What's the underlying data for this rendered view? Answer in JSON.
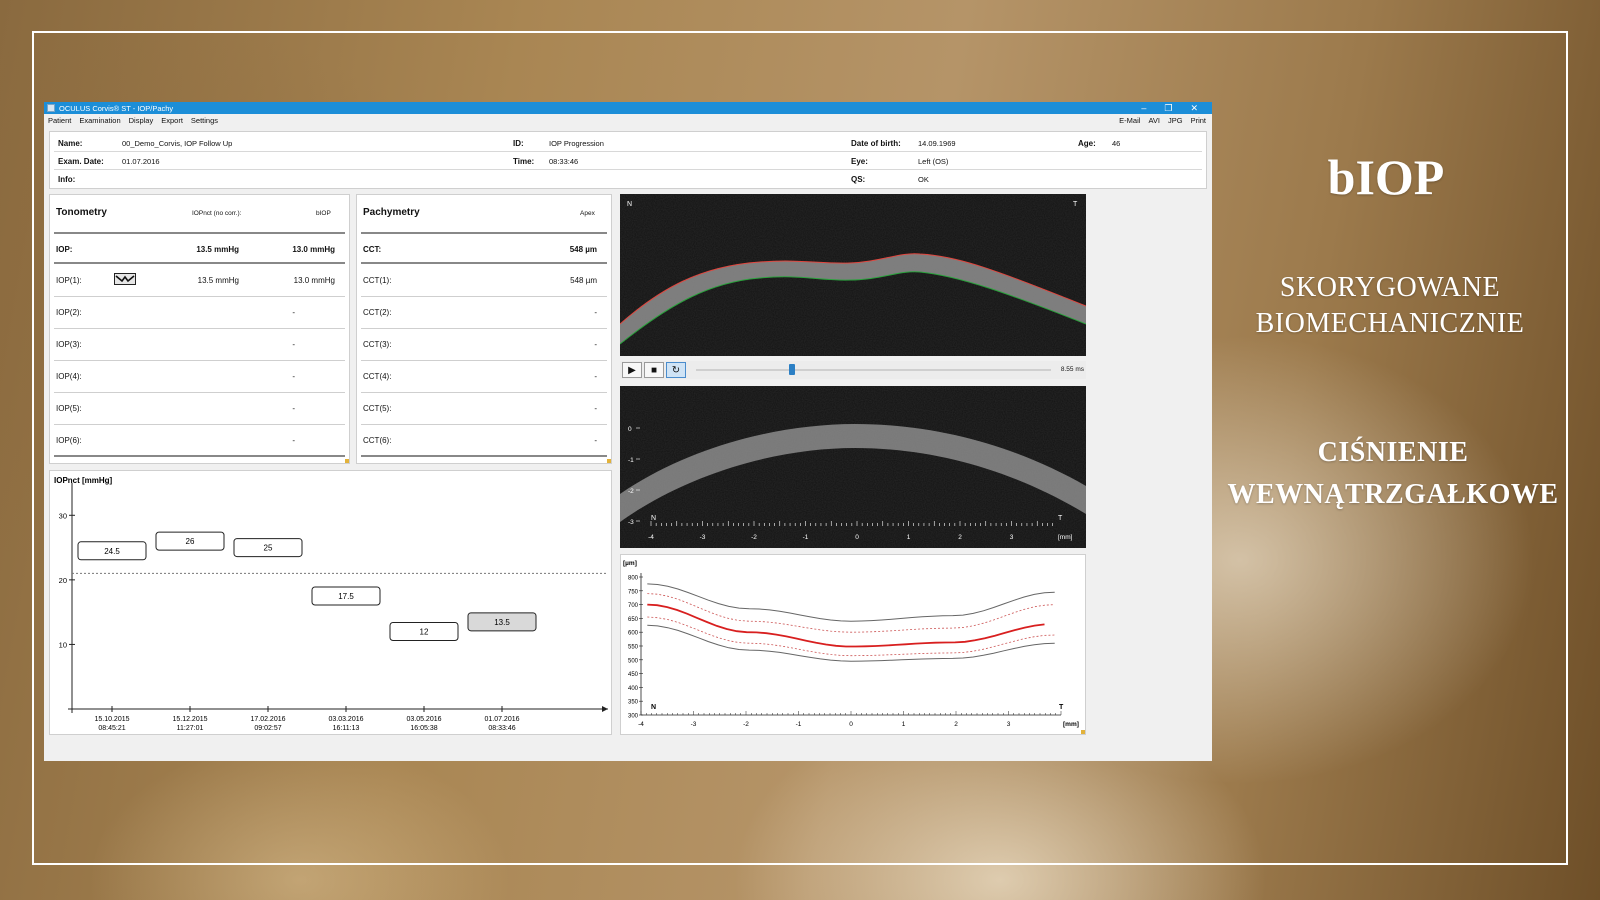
{
  "slide": {
    "title": "bIOP",
    "line1": "SKORYGOWANE",
    "line2": "BIOMECHANICZNIE",
    "line3": "CIŚNIENIE",
    "line4": "WEWNĄTRZGAŁKOWE"
  },
  "window": {
    "title": "OCULUS Corvis® ST - IOP/Pachy",
    "minimize": "–",
    "maximize": "❐",
    "close": "✕"
  },
  "menu": {
    "items": [
      "Patient",
      "Examination",
      "Display",
      "Export",
      "Settings"
    ],
    "right": [
      "E-Mail",
      "AVI",
      "JPG",
      "Print"
    ]
  },
  "patient": {
    "name_label": "Name:",
    "name": "00_Demo_Corvis, IOP Follow Up",
    "id_label": "ID:",
    "id": "IOP Progression",
    "dob_label": "Date of birth:",
    "dob": "14.09.1969",
    "age_label": "Age:",
    "age": "46",
    "exam_label": "Exam. Date:",
    "exam": "01.07.2016",
    "time_label": "Time:",
    "time": "08:33:46",
    "eye_label": "Eye:",
    "eye": "Left (OS)",
    "info_label": "Info:",
    "qs_label": "QS:",
    "qs": "OK"
  },
  "tonometry": {
    "title": "Tonometry",
    "col1": "IOPnct (no corr.):",
    "col2": "bIOP",
    "rows": [
      {
        "label": "IOP:",
        "v1": "13.5 mmHg",
        "v2": "13.0 mmHg"
      },
      {
        "label": "IOP(1):",
        "v1": "13.5 mmHg",
        "v2": "13.0 mmHg"
      },
      {
        "label": "IOP(2):",
        "v1": "",
        "v2": "-"
      },
      {
        "label": "IOP(3):",
        "v1": "",
        "v2": "-"
      },
      {
        "label": "IOP(4):",
        "v1": "",
        "v2": "-"
      },
      {
        "label": "IOP(5):",
        "v1": "",
        "v2": "-"
      },
      {
        "label": "IOP(6):",
        "v1": "",
        "v2": "-"
      }
    ]
  },
  "pachymetry": {
    "title": "Pachymetry",
    "col": "Apex",
    "rows": [
      {
        "label": "CCT:",
        "v": "548 µm"
      },
      {
        "label": "CCT(1):",
        "v": "548 µm"
      },
      {
        "label": "CCT(2):",
        "v": "-"
      },
      {
        "label": "CCT(3):",
        "v": "-"
      },
      {
        "label": "CCT(4):",
        "v": "-"
      },
      {
        "label": "CCT(5):",
        "v": "-"
      },
      {
        "label": "CCT(6):",
        "v": "-"
      }
    ]
  },
  "scheimpflug": {
    "top_left": "N",
    "top_right": "T",
    "time": "8.55 ms",
    "slider_fraction": 0.27,
    "bottom_left": "N",
    "bottom_right": "T",
    "x_unit": "[mm]",
    "x_ticks": [
      "-4",
      "-3",
      "-2",
      "-1",
      "0",
      "1",
      "2",
      "3"
    ],
    "y_ticks": [
      "0",
      "-1",
      "-2",
      "-3"
    ]
  },
  "colors": {
    "accent": "#1c8ed8",
    "outer_edge": "#e0473f",
    "inner_edge": "#2aa33c",
    "thickness_mean": "#d81f1f",
    "selected_box": "#d9d9d9"
  },
  "chart_data": [
    {
      "type": "line",
      "ylabel": "IOPnct [mmHg]",
      "ylim": [
        0,
        35
      ],
      "yticks": [
        10,
        20,
        30
      ],
      "reference_line": 21,
      "x": [
        {
          "date": "15.10.2015",
          "time": "08:45:21"
        },
        {
          "date": "15.12.2015",
          "time": "11:27:01"
        },
        {
          "date": "17.02.2016",
          "time": "09:02:57"
        },
        {
          "date": "03.03.2016",
          "time": "16:11:13"
        },
        {
          "date": "03.05.2016",
          "time": "16:05:38"
        },
        {
          "date": "01.07.2016",
          "time": "08:33:46"
        }
      ],
      "values": [
        24.5,
        26,
        25,
        17.5,
        12,
        13.5
      ],
      "labels": [
        "24.5",
        "26",
        "25",
        "17.5",
        "12",
        "13.5"
      ],
      "selected_index": 5
    },
    {
      "type": "line",
      "ylabel": "[µm]",
      "xlabel": "[mm]",
      "left_label": "N",
      "right_label": "T",
      "ylim": [
        300,
        800
      ],
      "yticks": [
        300,
        350,
        400,
        450,
        500,
        550,
        600,
        650,
        700,
        750,
        800
      ],
      "xlim": [
        -4,
        4
      ],
      "xticks": [
        -4,
        -3,
        -2,
        -1,
        0,
        1,
        2,
        3
      ],
      "series": [
        {
          "role": "upper",
          "x": [
            -4,
            -2,
            0,
            2,
            4
          ],
          "values": [
            775,
            685,
            640,
            660,
            745
          ]
        },
        {
          "role": "upper-inner",
          "x": [
            -4,
            -2,
            0,
            2,
            4
          ],
          "values": [
            740,
            640,
            600,
            615,
            700
          ]
        },
        {
          "role": "mean",
          "x": [
            -4,
            -2,
            0,
            2,
            4
          ],
          "values": [
            700,
            600,
            548,
            563,
            630
          ]
        },
        {
          "role": "lower-inner",
          "x": [
            -4,
            -2,
            0,
            2,
            4
          ],
          "values": [
            655,
            560,
            515,
            525,
            590
          ]
        },
        {
          "role": "lower",
          "x": [
            -4,
            -2,
            0,
            2,
            4
          ],
          "values": [
            625,
            535,
            495,
            505,
            560
          ]
        }
      ]
    }
  ]
}
